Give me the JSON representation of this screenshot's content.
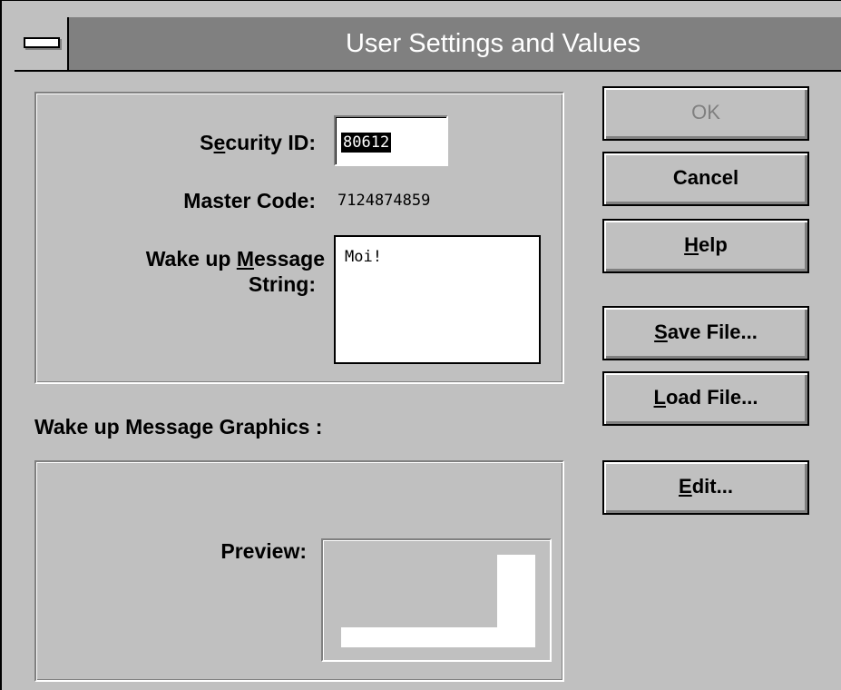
{
  "window": {
    "title": "User Settings and Values"
  },
  "form": {
    "security_id": {
      "label_pre": "S",
      "label_mnemonic": "e",
      "label_post": "curity ID:",
      "value": "80612"
    },
    "master_code": {
      "label": "Master Code:",
      "value": "7124874859"
    },
    "wake_message": {
      "label_pre": "Wake up ",
      "label_mnemonic": "M",
      "label_post": "essage",
      "label_line2": "String:",
      "value": "Moi!"
    }
  },
  "graphics": {
    "section_label": "Wake up Message Graphics :",
    "preview_label": "Preview:"
  },
  "buttons": {
    "ok": {
      "label": "OK"
    },
    "cancel": {
      "label": "Cancel"
    },
    "help": {
      "mnemonic": "H",
      "rest": "elp"
    },
    "save": {
      "mnemonic": "S",
      "rest": "ave File..."
    },
    "load": {
      "mnemonic": "L",
      "rest": "oad File..."
    },
    "edit": {
      "mnemonic": "E",
      "rest": "dit..."
    }
  },
  "colors": {
    "face": "#c0c0c0",
    "title_bar": "#808080",
    "shadow": "#808080",
    "highlight": "#ffffff"
  }
}
